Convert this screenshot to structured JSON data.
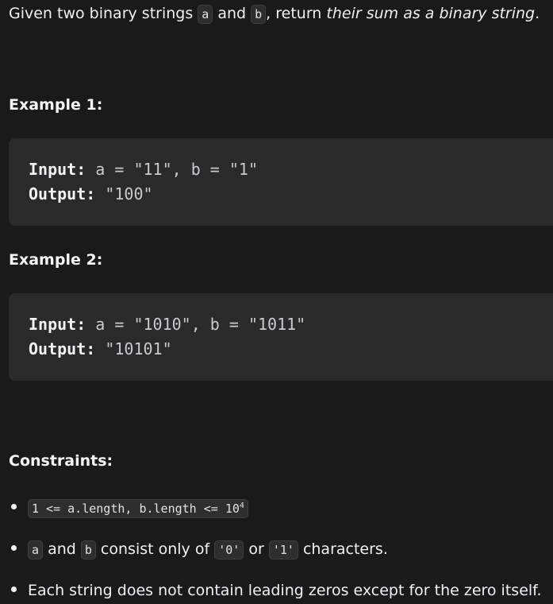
{
  "intro": {
    "prefix": "Given two binary strings ",
    "code_a": "a",
    "and": " and ",
    "code_b": "b",
    "middle": ", return ",
    "emphasis": "their sum as a binary string",
    "end": "."
  },
  "examples": [
    {
      "heading": "Example 1:",
      "input_label": "Input:",
      "input_value": " a = \"11\", b = \"1\"",
      "output_label": "Output:",
      "output_value": " \"100\""
    },
    {
      "heading": "Example 2:",
      "input_label": "Input:",
      "input_value": " a = \"1010\", b = \"1011\"",
      "output_label": "Output:",
      "output_value": " \"10101\""
    }
  ],
  "constraints": {
    "heading": "Constraints:",
    "c1_code": "1 <= a.length, b.length <= 10",
    "c1_sup": "4",
    "c2_code_a": "a",
    "c2_and": " and ",
    "c2_code_b": "b",
    "c2_mid": " consist only of ",
    "c2_code_0": "'0'",
    "c2_or": " or ",
    "c2_code_1": "'1'",
    "c2_end": " characters.",
    "c3_text": "Each string does not contain leading zeros except for the zero itself."
  }
}
